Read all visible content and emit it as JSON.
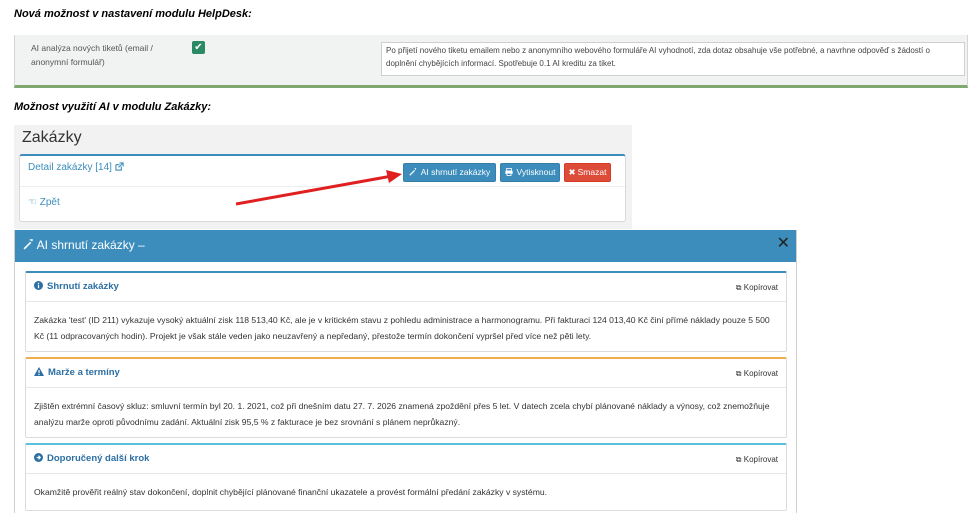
{
  "helpdesk_heading": "Nová možnost v nastavení modulu HelpDesk:",
  "helpdesk": {
    "label": "AI analýza nových tiketů (email / anonymní formulář)",
    "checked_icon": "check-icon",
    "description": "Po přijetí nového tiketu emailem nebo z anonymního webového formuláře AI vyhodnotí, zda dotaz obsahuje vše potřebné, a navrhne odpověď s žádostí o doplnění chybějících informací. Spotřebuje 0.1 AI kreditu za tiket."
  },
  "zakazky_heading": "Možnost využití AI v modulu Zakázky:",
  "zakazky": {
    "title": "Zakázky",
    "detail_link": "Detail zakázky [14]",
    "ai_button": "AI shrnutí zakázky",
    "print_button": "Vytisknout",
    "delete_button": "Smazat",
    "back_link": "Zpět"
  },
  "modal": {
    "title": "AI shrnutí zakázky –",
    "copy_label": "Kopírovat",
    "sections": [
      {
        "title": "Shrnutí zakázky",
        "icon": "info-icon",
        "text": "Zakázka 'test' (ID 211) vykazuje vysoký aktuální zisk 118 513,40 Kč, ale je v kritickém stavu z pohledu administrace a harmonogramu. Při fakturaci 124 013,40 Kč činí přímé náklady pouze 5 500 Kč (11 odpracovaných hodin). Projekt je však stále veden jako neuzavřený a nepředaný, přestože termín dokončení vypršel před více než pěti lety."
      },
      {
        "title": "Marže a termíny",
        "icon": "warning-icon",
        "text": "Zjištěn extrémní časový skluz: smluvní termín byl 20. 1. 2021, což při dnešním datu 27. 7. 2026 znamená zpoždění přes 5 let. V datech zcela chybí plánované náklady a výnosy, což znemožňuje analýzu marže oproti původnímu zadání. Aktuální zisk 95,5 % z fakturace je bez srovnání s plánem neprůkazný."
      },
      {
        "title": "Doporučený další krok",
        "icon": "arrow-circle-right-icon",
        "text": "Okamžitě prověřit reálný stav dokončení, doplnit chybějící plánované finanční ukazatele a provést formální předání zakázky v systému."
      }
    ]
  }
}
